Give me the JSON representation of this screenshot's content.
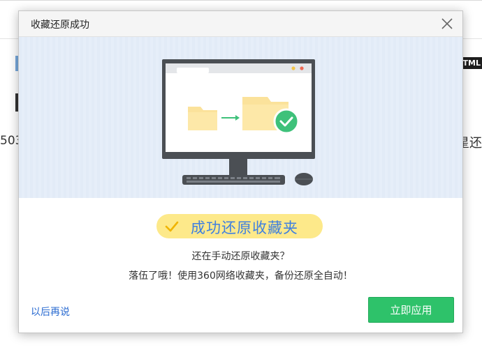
{
  "background": {
    "left_text": "503",
    "right_badge": "TML",
    "right_text": "星还"
  },
  "dialog": {
    "title": "收藏还原成功",
    "success_label": "成功还原收藏夹",
    "message_line1": "还在手动还原收藏夹？",
    "message_line2": "落伍了哦！使用360网络收藏夹，备份还原全自动！",
    "later_link": "以后再说",
    "apply_button": "立即应用",
    "icons": {
      "close": "close-icon",
      "check": "check-icon",
      "illustration": "monitor-folder-restore-illustration"
    },
    "colors": {
      "accent_green": "#2ec26a",
      "success_pill": "#fde98a",
      "link_blue": "#2a6bd1",
      "banner_bg": "#e6eef9"
    }
  }
}
